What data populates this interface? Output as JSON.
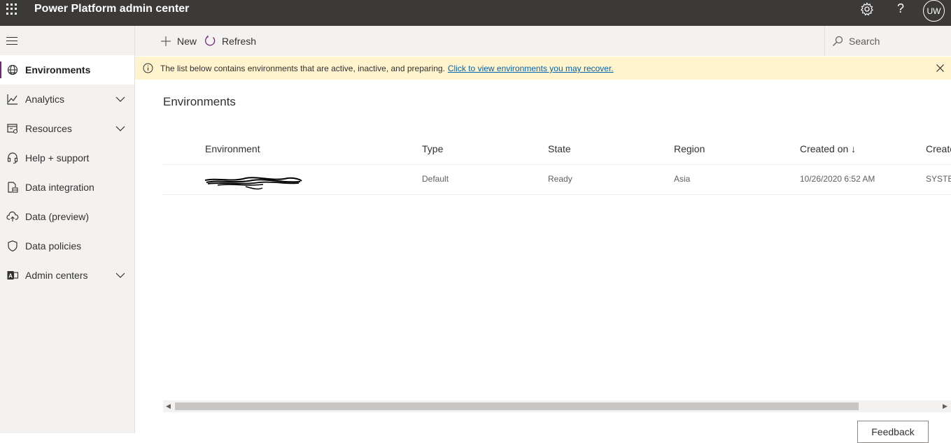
{
  "header": {
    "app_title": "Power Platform admin center",
    "avatar_initials": "UW",
    "help_glyph": "?"
  },
  "sidebar": {
    "items": [
      {
        "label": "Environments",
        "icon": "globe-icon",
        "active": true
      },
      {
        "label": "Analytics",
        "icon": "chart-icon",
        "expandable": true
      },
      {
        "label": "Resources",
        "icon": "resources-icon",
        "expandable": true
      },
      {
        "label": "Help + support",
        "icon": "headset-icon"
      },
      {
        "label": "Data integration",
        "icon": "data-integration-icon"
      },
      {
        "label": "Data (preview)",
        "icon": "cloud-upload-icon"
      },
      {
        "label": "Data policies",
        "icon": "shield-icon"
      },
      {
        "label": "Admin centers",
        "icon": "admin-centers-icon",
        "expandable": true
      }
    ]
  },
  "commandbar": {
    "new_label": "New",
    "refresh_label": "Refresh",
    "search_placeholder": "Search"
  },
  "banner": {
    "text": "The list below contains environments that are active, inactive, and preparing.",
    "link_text": "Click to view environments you may recover."
  },
  "main": {
    "title": "Environments",
    "columns": [
      "Environment",
      "Type",
      "State",
      "Region",
      "Created on ↓",
      "Created by"
    ],
    "rows": [
      {
        "environment": "(redacted)",
        "type": "Default",
        "state": "Ready",
        "region": "Asia",
        "created_on": "10/26/2020 6:52 AM",
        "created_by": "SYSTEM"
      }
    ]
  },
  "feedback_label": "Feedback",
  "colors": {
    "topbar": "#3b3a39",
    "accent": "#742774",
    "banner": "#fff4ce",
    "link": "#0063b1"
  }
}
